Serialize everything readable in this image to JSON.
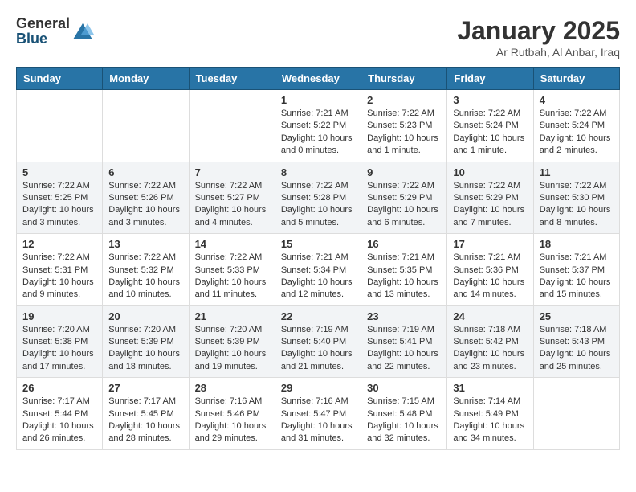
{
  "header": {
    "logo_general": "General",
    "logo_blue": "Blue",
    "month_title": "January 2025",
    "location": "Ar Rutbah, Al Anbar, Iraq"
  },
  "days_of_week": [
    "Sunday",
    "Monday",
    "Tuesday",
    "Wednesday",
    "Thursday",
    "Friday",
    "Saturday"
  ],
  "weeks": [
    [
      {
        "day": "",
        "content": ""
      },
      {
        "day": "",
        "content": ""
      },
      {
        "day": "",
        "content": ""
      },
      {
        "day": "1",
        "content": "Sunrise: 7:21 AM\nSunset: 5:22 PM\nDaylight: 10 hours\nand 0 minutes."
      },
      {
        "day": "2",
        "content": "Sunrise: 7:22 AM\nSunset: 5:23 PM\nDaylight: 10 hours\nand 1 minute."
      },
      {
        "day": "3",
        "content": "Sunrise: 7:22 AM\nSunset: 5:24 PM\nDaylight: 10 hours\nand 1 minute."
      },
      {
        "day": "4",
        "content": "Sunrise: 7:22 AM\nSunset: 5:24 PM\nDaylight: 10 hours\nand 2 minutes."
      }
    ],
    [
      {
        "day": "5",
        "content": "Sunrise: 7:22 AM\nSunset: 5:25 PM\nDaylight: 10 hours\nand 3 minutes."
      },
      {
        "day": "6",
        "content": "Sunrise: 7:22 AM\nSunset: 5:26 PM\nDaylight: 10 hours\nand 3 minutes."
      },
      {
        "day": "7",
        "content": "Sunrise: 7:22 AM\nSunset: 5:27 PM\nDaylight: 10 hours\nand 4 minutes."
      },
      {
        "day": "8",
        "content": "Sunrise: 7:22 AM\nSunset: 5:28 PM\nDaylight: 10 hours\nand 5 minutes."
      },
      {
        "day": "9",
        "content": "Sunrise: 7:22 AM\nSunset: 5:29 PM\nDaylight: 10 hours\nand 6 minutes."
      },
      {
        "day": "10",
        "content": "Sunrise: 7:22 AM\nSunset: 5:29 PM\nDaylight: 10 hours\nand 7 minutes."
      },
      {
        "day": "11",
        "content": "Sunrise: 7:22 AM\nSunset: 5:30 PM\nDaylight: 10 hours\nand 8 minutes."
      }
    ],
    [
      {
        "day": "12",
        "content": "Sunrise: 7:22 AM\nSunset: 5:31 PM\nDaylight: 10 hours\nand 9 minutes."
      },
      {
        "day": "13",
        "content": "Sunrise: 7:22 AM\nSunset: 5:32 PM\nDaylight: 10 hours\nand 10 minutes."
      },
      {
        "day": "14",
        "content": "Sunrise: 7:22 AM\nSunset: 5:33 PM\nDaylight: 10 hours\nand 11 minutes."
      },
      {
        "day": "15",
        "content": "Sunrise: 7:21 AM\nSunset: 5:34 PM\nDaylight: 10 hours\nand 12 minutes."
      },
      {
        "day": "16",
        "content": "Sunrise: 7:21 AM\nSunset: 5:35 PM\nDaylight: 10 hours\nand 13 minutes."
      },
      {
        "day": "17",
        "content": "Sunrise: 7:21 AM\nSunset: 5:36 PM\nDaylight: 10 hours\nand 14 minutes."
      },
      {
        "day": "18",
        "content": "Sunrise: 7:21 AM\nSunset: 5:37 PM\nDaylight: 10 hours\nand 15 minutes."
      }
    ],
    [
      {
        "day": "19",
        "content": "Sunrise: 7:20 AM\nSunset: 5:38 PM\nDaylight: 10 hours\nand 17 minutes."
      },
      {
        "day": "20",
        "content": "Sunrise: 7:20 AM\nSunset: 5:39 PM\nDaylight: 10 hours\nand 18 minutes."
      },
      {
        "day": "21",
        "content": "Sunrise: 7:20 AM\nSunset: 5:39 PM\nDaylight: 10 hours\nand 19 minutes."
      },
      {
        "day": "22",
        "content": "Sunrise: 7:19 AM\nSunset: 5:40 PM\nDaylight: 10 hours\nand 21 minutes."
      },
      {
        "day": "23",
        "content": "Sunrise: 7:19 AM\nSunset: 5:41 PM\nDaylight: 10 hours\nand 22 minutes."
      },
      {
        "day": "24",
        "content": "Sunrise: 7:18 AM\nSunset: 5:42 PM\nDaylight: 10 hours\nand 23 minutes."
      },
      {
        "day": "25",
        "content": "Sunrise: 7:18 AM\nSunset: 5:43 PM\nDaylight: 10 hours\nand 25 minutes."
      }
    ],
    [
      {
        "day": "26",
        "content": "Sunrise: 7:17 AM\nSunset: 5:44 PM\nDaylight: 10 hours\nand 26 minutes."
      },
      {
        "day": "27",
        "content": "Sunrise: 7:17 AM\nSunset: 5:45 PM\nDaylight: 10 hours\nand 28 minutes."
      },
      {
        "day": "28",
        "content": "Sunrise: 7:16 AM\nSunset: 5:46 PM\nDaylight: 10 hours\nand 29 minutes."
      },
      {
        "day": "29",
        "content": "Sunrise: 7:16 AM\nSunset: 5:47 PM\nDaylight: 10 hours\nand 31 minutes."
      },
      {
        "day": "30",
        "content": "Sunrise: 7:15 AM\nSunset: 5:48 PM\nDaylight: 10 hours\nand 32 minutes."
      },
      {
        "day": "31",
        "content": "Sunrise: 7:14 AM\nSunset: 5:49 PM\nDaylight: 10 hours\nand 34 minutes."
      },
      {
        "day": "",
        "content": ""
      }
    ]
  ]
}
